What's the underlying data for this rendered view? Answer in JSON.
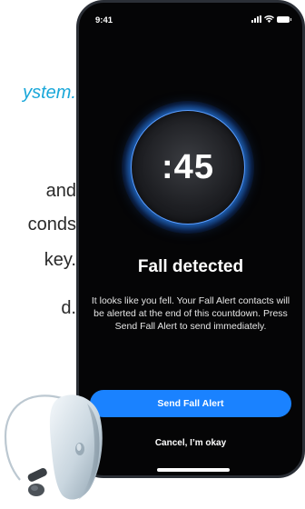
{
  "background_text": {
    "line1": "ystem.",
    "line2": "and",
    "line3": "conds",
    "line4": "key.",
    "line5": "d."
  },
  "phone": {
    "status_bar": {
      "time": "9:41"
    },
    "timer": {
      "value": ":45"
    },
    "title": "Fall detected",
    "description": "It looks like you fell. Your Fall Alert contacts will be alerted at the end of this countdown. Press Send Fall Alert to send immediately.",
    "primary_button": "Send Fall Alert",
    "secondary_button": "Cancel, I’m okay"
  },
  "colors": {
    "accent": "#1a82ff",
    "ring_glow": "#2d82ff",
    "screen_bg": "#050506",
    "link_text": "#19a7d9"
  }
}
